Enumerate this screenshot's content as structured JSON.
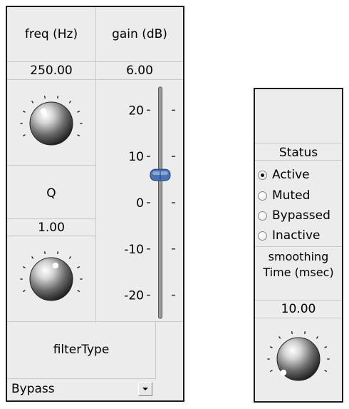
{
  "filter": {
    "freq_label": "freq (Hz)",
    "freq_value": "250.00",
    "gain_label": "gain (dB)",
    "gain_value": "6.00",
    "gain_db": 6.0,
    "q_label": "Q",
    "q_value": "1.00",
    "filtertype_label": "filterType",
    "filtertype_selected": "Bypass"
  },
  "gain_slider": {
    "min": -25,
    "max": 25,
    "ticks": [
      {
        "value": 20,
        "label": "20"
      },
      {
        "value": 10,
        "label": "10"
      },
      {
        "value": 0,
        "label": "0"
      },
      {
        "value": -10,
        "label": "-10"
      },
      {
        "value": -20,
        "label": "-20"
      }
    ]
  },
  "status": {
    "label": "Status",
    "options": [
      {
        "label": "Active",
        "checked": true
      },
      {
        "label": "Muted",
        "checked": false
      },
      {
        "label": "Bypassed",
        "checked": false
      },
      {
        "label": "Inactive",
        "checked": false
      }
    ]
  },
  "smoothing": {
    "label_line1": "smoothing",
    "label_line2": "Time (msec)",
    "value": "10.00"
  },
  "icons": {
    "knob": "rotary-knob-icon",
    "dropdown": "chevron-down-icon",
    "slider_thumb": "slider-thumb-icon"
  },
  "colors": {
    "panel_bg": "#ececec",
    "slider_thumb": "#4a72b0",
    "border": "#1a1a1a"
  }
}
